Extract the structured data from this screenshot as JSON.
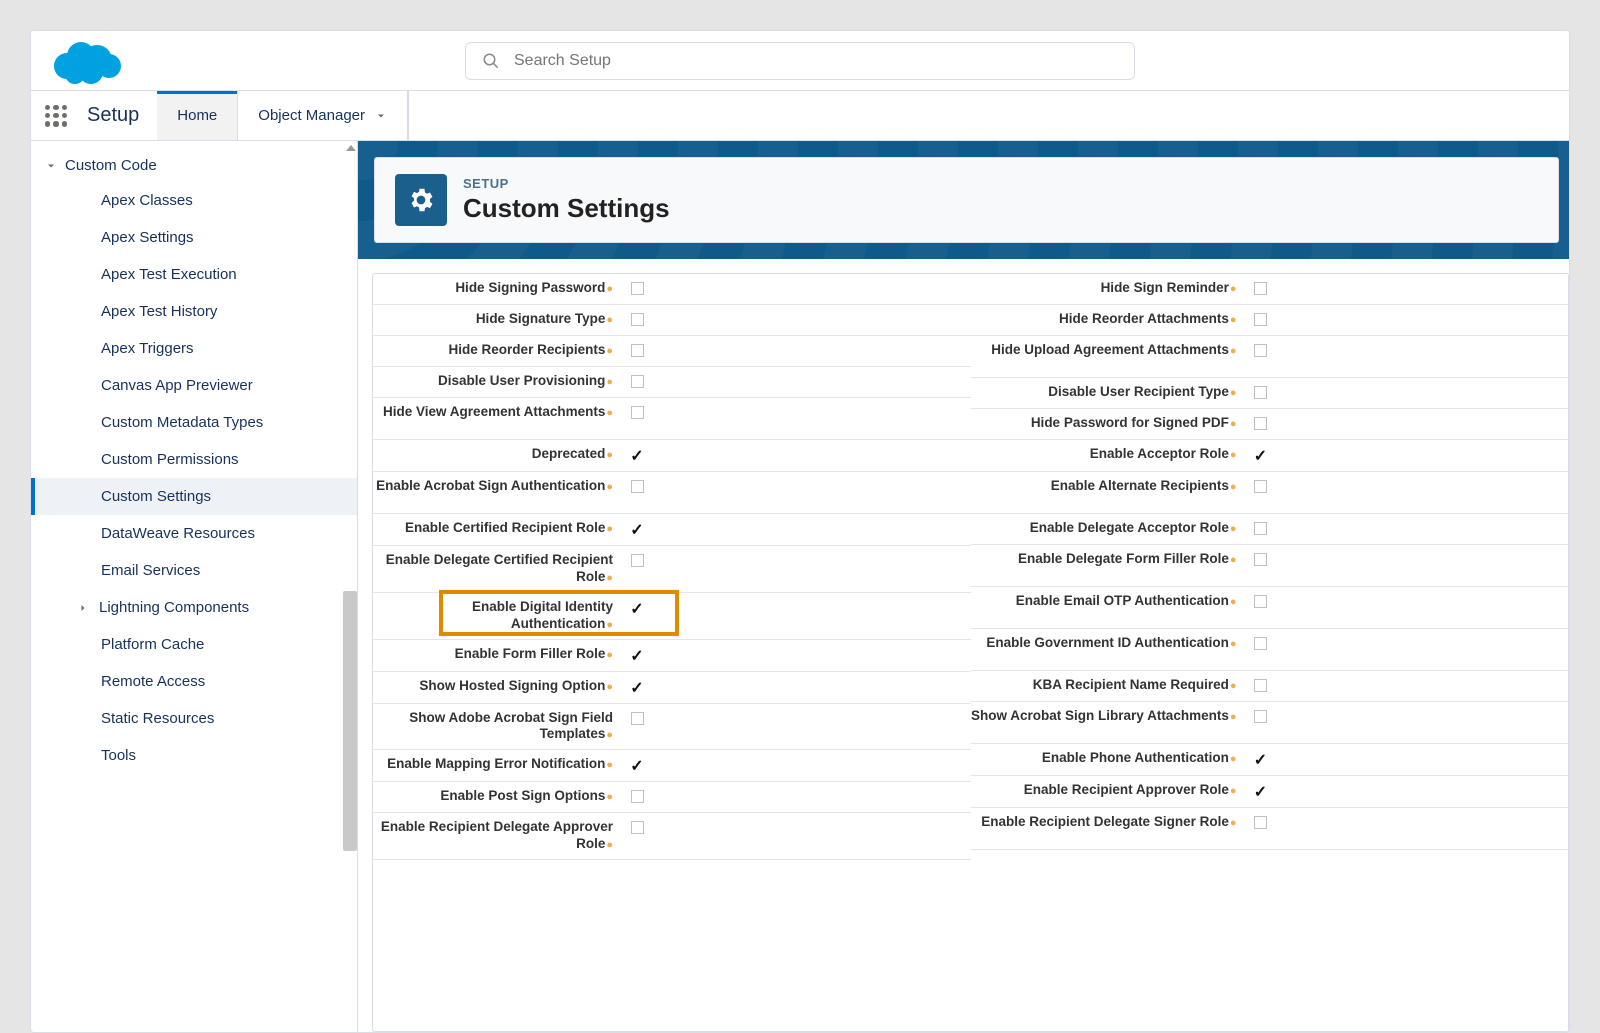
{
  "header": {
    "search_placeholder": "Search Setup"
  },
  "nav": {
    "setup_label": "Setup",
    "tabs": [
      "Home",
      "Object Manager"
    ],
    "active_tab_index": 0
  },
  "sidebar": {
    "section_label": "Custom Code",
    "items": [
      {
        "label": "Apex Classes",
        "selected": false
      },
      {
        "label": "Apex Settings",
        "selected": false
      },
      {
        "label": "Apex Test Execution",
        "selected": false
      },
      {
        "label": "Apex Test History",
        "selected": false
      },
      {
        "label": "Apex Triggers",
        "selected": false
      },
      {
        "label": "Canvas App Previewer",
        "selected": false
      },
      {
        "label": "Custom Metadata Types",
        "selected": false
      },
      {
        "label": "Custom Permissions",
        "selected": false
      },
      {
        "label": "Custom Settings",
        "selected": true
      },
      {
        "label": "DataWeave Resources",
        "selected": false
      },
      {
        "label": "Email Services",
        "selected": false
      },
      {
        "label": "Lightning Components",
        "selected": false,
        "expandable": true
      },
      {
        "label": "Platform Cache",
        "selected": false
      },
      {
        "label": "Remote Access",
        "selected": false
      },
      {
        "label": "Static Resources",
        "selected": false
      },
      {
        "label": "Tools",
        "selected": false
      }
    ]
  },
  "page": {
    "eyebrow": "SETUP",
    "title": "Custom Settings"
  },
  "settings": {
    "left": [
      {
        "label": "Hide Signing Password",
        "checked": false
      },
      {
        "label": "Hide Signature Type",
        "checked": false
      },
      {
        "label": "Hide Reorder Recipients",
        "checked": false
      },
      {
        "label": "Disable User Provisioning",
        "checked": false
      },
      {
        "label": "Hide View Agreement Attachments",
        "checked": false,
        "tall": true
      },
      {
        "label": "Deprecated",
        "checked": true
      },
      {
        "label": "Enable Acrobat Sign Authentication",
        "checked": false,
        "tall": true
      },
      {
        "label": "Enable Certified Recipient Role",
        "checked": true
      },
      {
        "label": "Enable Delegate Certified Recipient Role",
        "checked": false,
        "tall": true
      },
      {
        "label": "Enable Digital Identity Authentication",
        "checked": true,
        "tall": true,
        "highlighted": true
      },
      {
        "label": "Enable Form Filler Role",
        "checked": true
      },
      {
        "label": "Show Hosted Signing Option",
        "checked": true
      },
      {
        "label": "Show Adobe Acrobat Sign Field Templates",
        "checked": false,
        "tall": true
      },
      {
        "label": "Enable Mapping Error Notification",
        "checked": true
      },
      {
        "label": "Enable Post Sign Options",
        "checked": false
      },
      {
        "label": "Enable Recipient Delegate Approver Role",
        "checked": false,
        "tall": true
      }
    ],
    "right": [
      {
        "label": "Hide Sign Reminder",
        "checked": false
      },
      {
        "label": "Hide Reorder Attachments",
        "checked": false
      },
      {
        "label": "Hide Upload Agreement Attachments",
        "checked": false,
        "tall": true
      },
      {
        "label": "Disable User Recipient Type",
        "checked": false
      },
      {
        "label": "Hide Password for Signed PDF",
        "checked": false
      },
      {
        "label": "Enable Acceptor Role",
        "checked": true
      },
      {
        "label": "Enable Alternate Recipients",
        "checked": false,
        "tall": true
      },
      {
        "label": "Enable Delegate Acceptor Role",
        "checked": false
      },
      {
        "label": "Enable Delegate Form Filler Role",
        "checked": false,
        "tall": true
      },
      {
        "label": "Enable Email OTP Authentication",
        "checked": false,
        "tall": true
      },
      {
        "label": "Enable Government ID Authentication",
        "checked": false,
        "tall": true
      },
      {
        "label": "KBA Recipient Name Required",
        "checked": false
      },
      {
        "label": "Show Acrobat Sign Library Attachments",
        "checked": false,
        "tall": true
      },
      {
        "label": "Enable Phone Authentication",
        "checked": true
      },
      {
        "label": "Enable Recipient Approver Role",
        "checked": true
      },
      {
        "label": "Enable Recipient Delegate Signer Role",
        "checked": false,
        "tall": true
      }
    ]
  }
}
